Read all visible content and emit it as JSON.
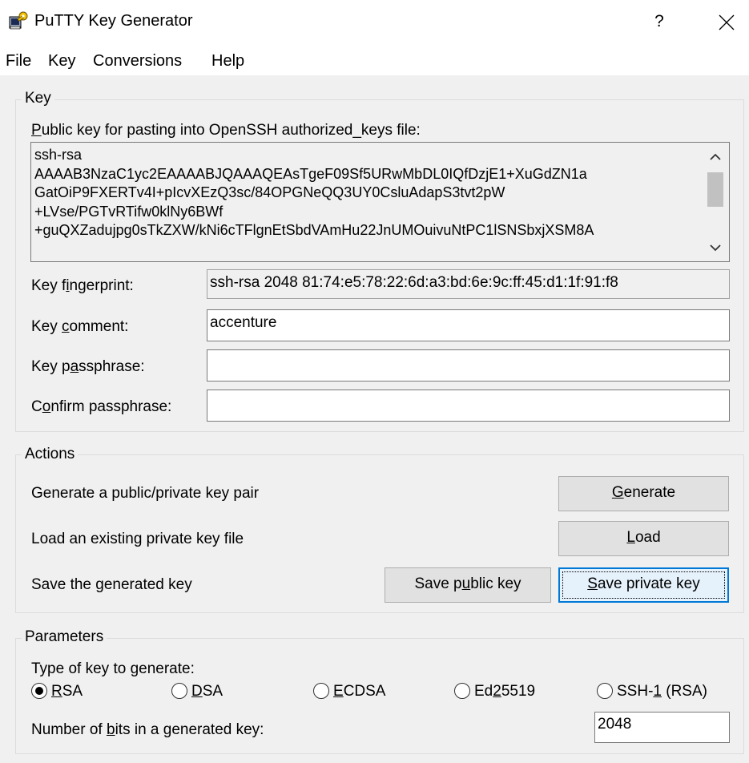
{
  "window": {
    "title": "PuTTY Key Generator",
    "help_glyph": "?",
    "close_glyph": "✕"
  },
  "menu": [
    "File",
    "Key",
    "Conversions",
    "Help"
  ],
  "key_group": {
    "label": "Key",
    "public_key_label_u": "P",
    "public_key_label_rest": "ublic key for pasting into OpenSSH authorized_keys file:",
    "public_key_lines": [
      "ssh-rsa",
      "AAAAB3NzaC1yc2EAAAABJQAAAQEAsTgeF09Sf5URwMbDL0IQfDzjE1+XuGdZN1a",
      "GatOiP9FXERTv4I+pIcvXEzQ3sc/84OPGNeQQ3UY0CsluAdapS3tvt2pW",
      "+LVse/PGTvRTifw0klNy6BWf",
      "+guQXZadujpg0sTkZXW/kNi6cTFlgnEtSbdVAmHu22JnUMOuivuNtPC1lSNSbxjXSM8A"
    ],
    "fingerprint_label_a": "Key f",
    "fingerprint_label_u": "i",
    "fingerprint_label_b": "ngerprint:",
    "fingerprint_value": "ssh-rsa 2048 81:74:e5:78:22:6d:a3:bd:6e:9c:ff:45:d1:1f:91:f8",
    "comment_label_a": "Key ",
    "comment_label_u": "c",
    "comment_label_b": "omment:",
    "comment_value": "accenture",
    "passphrase_label_a": "Key p",
    "passphrase_label_u": "a",
    "passphrase_label_b": "ssphrase:",
    "passphrase_value": "",
    "confirm_label_a": "C",
    "confirm_label_u": "o",
    "confirm_label_b": "nfirm passphrase:",
    "confirm_value": ""
  },
  "actions_group": {
    "label": "Actions",
    "generate_text": "Generate a public/private key pair",
    "generate_btn_u": "G",
    "generate_btn_rest": "enerate",
    "load_text": "Load an existing private key file",
    "load_btn_u": "L",
    "load_btn_rest": "oad",
    "save_text": "Save the generated key",
    "save_public_a": "Save p",
    "save_public_u": "u",
    "save_public_b": "blic key",
    "save_private_u": "S",
    "save_private_rest": "ave private key"
  },
  "parameters_group": {
    "label": "Parameters",
    "type_label": "Type of key to generate:",
    "key_types": [
      {
        "u": "R",
        "rest_a": "",
        "rest_b": "SA",
        "selected": true
      },
      {
        "u": "D",
        "rest_a": "",
        "rest_b": "SA",
        "selected": false
      },
      {
        "u": "E",
        "rest_a": "",
        "rest_b": "CDSA",
        "selected": false
      },
      {
        "u": "2",
        "rest_a": "Ed",
        "rest_b": "5519",
        "selected": false
      },
      {
        "u": "1",
        "rest_a": "SSH-",
        "rest_b": " (RSA)",
        "selected": false
      }
    ],
    "bits_label_a": "Number of ",
    "bits_label_u": "b",
    "bits_label_b": "its in a generated key:",
    "bits_value": "2048"
  }
}
